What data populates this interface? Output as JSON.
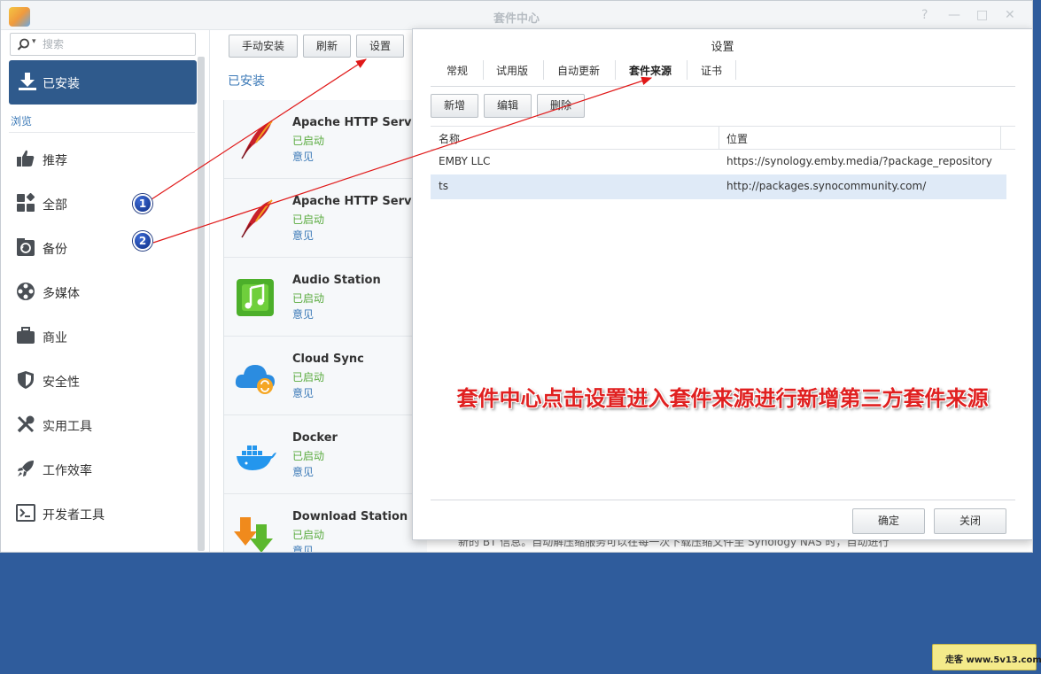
{
  "window": {
    "title": "套件中心",
    "controls": [
      "?",
      "—",
      "□",
      "✕"
    ]
  },
  "sidebar": {
    "search_placeholder": "搜索",
    "installed_label": "已安装",
    "browse_label": "浏览",
    "categories": [
      {
        "label": "推荐",
        "icon": "thumbs-up-icon"
      },
      {
        "label": "全部",
        "icon": "grid-icon"
      },
      {
        "label": "备份",
        "icon": "backup-icon"
      },
      {
        "label": "多媒体",
        "icon": "film-reel-icon"
      },
      {
        "label": "商业",
        "icon": "briefcase-icon"
      },
      {
        "label": "安全性",
        "icon": "shield-icon"
      },
      {
        "label": "实用工具",
        "icon": "tools-icon"
      },
      {
        "label": "工作效率",
        "icon": "rocket-icon"
      },
      {
        "label": "开发者工具",
        "icon": "terminal-icon"
      }
    ]
  },
  "toolbar": {
    "manual_install": "手动安装",
    "refresh": "刷新",
    "settings": "设置"
  },
  "main": {
    "title": "已安装",
    "packages": [
      {
        "name": "Apache HTTP Server",
        "status": "已启动",
        "feedback": "意见",
        "icon": "apache-feather-icon"
      },
      {
        "name": "Apache HTTP Server",
        "status": "已启动",
        "feedback": "意见",
        "icon": "apache-feather-icon"
      },
      {
        "name": "Audio Station",
        "status": "已启动",
        "feedback": "意见",
        "icon": "music-note-icon"
      },
      {
        "name": "Cloud Sync",
        "status": "已启动",
        "feedback": "意见",
        "icon": "cloud-sync-icon"
      },
      {
        "name": "Docker",
        "status": "已启动",
        "feedback": "意见",
        "icon": "docker-whale-icon"
      },
      {
        "name": "Download Station",
        "status": "已启动",
        "feedback": "意见",
        "icon": "download-arrows-icon"
      }
    ],
    "description": "新的 BT 信息。自动解压缩服务可以在每一次下载压缩文件至 Synology NAS 时，自动进行"
  },
  "dialog": {
    "title": "设置",
    "tabs": [
      "常规",
      "试用版",
      "自动更新",
      "套件来源",
      "证书"
    ],
    "active_tab": "套件来源",
    "buttons": {
      "add": "新增",
      "edit": "编辑",
      "delete": "删除"
    },
    "columns": {
      "name": "名称",
      "location": "位置"
    },
    "rows": [
      {
        "name": "EMBY LLC",
        "location": "https://synology.emby.media/?package_repository"
      },
      {
        "name": "ts",
        "location": "http://packages.synocommunity.com/"
      }
    ],
    "ok": "确定",
    "close": "关闭"
  },
  "annotation": {
    "text": "套件中心点击设置进入套件来源进行新增第三方套件来源",
    "steps": [
      "1",
      "2"
    ],
    "color": "#e02020"
  },
  "watermark": "走客 www.5v13.com",
  "colors": {
    "accent": "#2f5a8c",
    "link": "#3b79b7",
    "status": "#5aab3f",
    "desktop": "#2f5c9c"
  }
}
